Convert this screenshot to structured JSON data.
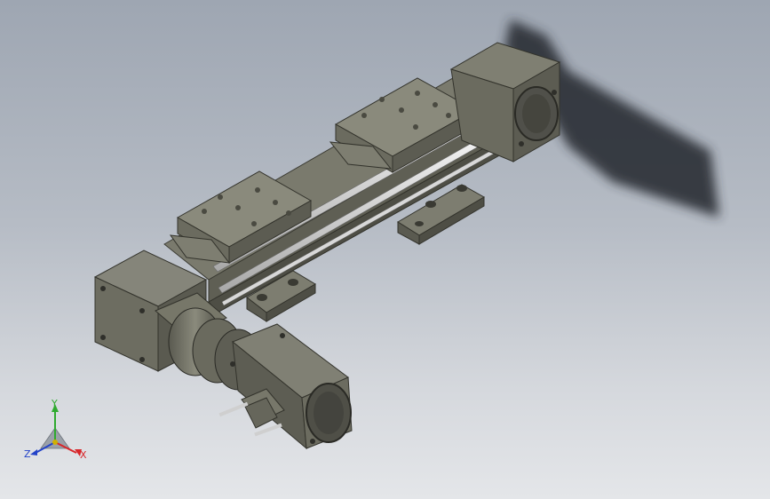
{
  "viewport": {
    "background_top": "#9ea6b2",
    "background_bottom": "#e4e6e9"
  },
  "model": {
    "body_color": "#6e6e62",
    "body_dark": "#4f4f45",
    "body_light": "#8d8d7f",
    "rail_color": "#e8e8e8",
    "shadow_color": "#2b2f36"
  },
  "triad": {
    "x_label": "X",
    "y_label": "Y",
    "z_label": "Z",
    "x_color": "#d8262a",
    "y_color": "#2faa2f",
    "z_color": "#2343c8"
  }
}
